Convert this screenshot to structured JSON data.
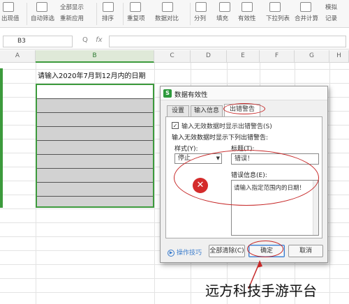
{
  "ribbon": {
    "items": [
      {
        "name": "highlight-duplicates",
        "label": "出现值"
      },
      {
        "name": "auto-filter",
        "label": "自动筛选"
      },
      {
        "name": "show-all",
        "label": "全部显示"
      },
      {
        "name": "reapply",
        "label": "重新应用"
      },
      {
        "name": "sort",
        "label": "排序"
      },
      {
        "name": "duplicates",
        "label": "重复项"
      },
      {
        "name": "data-compare",
        "label": "数据对比"
      },
      {
        "name": "split",
        "label": "分列"
      },
      {
        "name": "fill",
        "label": "填充"
      },
      {
        "name": "validity",
        "label": "有效性"
      },
      {
        "name": "dropdown-list",
        "label": "下拉列表"
      },
      {
        "name": "merge-calc",
        "label": "合并计算"
      },
      {
        "name": "simulate",
        "label": "模拟"
      },
      {
        "name": "record",
        "label": "记录"
      }
    ],
    "icon_symbol": "Ā"
  },
  "formula_bar": {
    "cell_ref": "B3",
    "fx": "fx",
    "zoom_icon": "Q"
  },
  "columns": [
    "A",
    "B",
    "C",
    "D",
    "E",
    "F",
    "G",
    "H"
  ],
  "sheet": {
    "header_text": "请输入2020年7月到12月内的日期"
  },
  "dialog": {
    "title": "数据有效性",
    "app_icon": "S",
    "tabs": [
      "设置",
      "输入信息",
      "出错警告"
    ],
    "active_tab": "出错警告",
    "show_error_checkbox": {
      "checked": true,
      "label": "输入无效数据时显示出错警告(S)"
    },
    "section_label": "输入无效数据时显示下列出错警告:",
    "style_label": "样式(Y):",
    "style_value": "停止",
    "title_label": "标题(T):",
    "title_value": "错误！",
    "message_label": "错误信息(E):",
    "message_value": "请输入指定范围内的日期！",
    "tips_label": "操作技巧",
    "buttons": {
      "clear_all": "全部清除(C)",
      "ok": "确定",
      "cancel": "取消"
    }
  },
  "annotation": {
    "highlight_color": "#c62828"
  },
  "watermark": "远方科技手游平台"
}
